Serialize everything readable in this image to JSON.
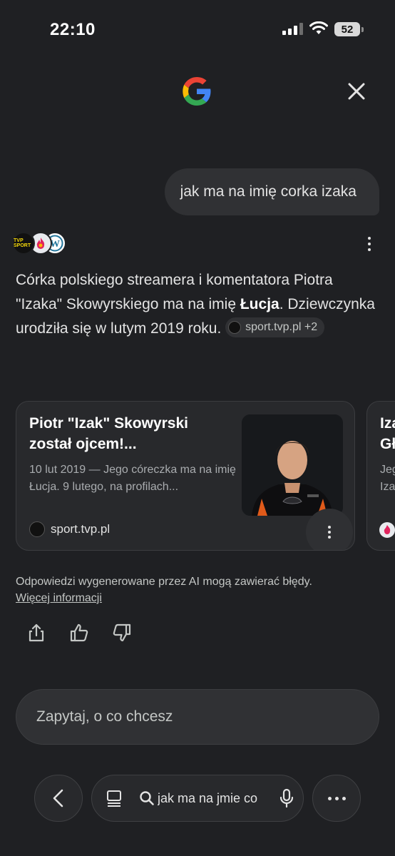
{
  "status_bar": {
    "time": "22:10",
    "battery": "52"
  },
  "conversation": {
    "query": "jak ma na imię corka izaka",
    "sources_icons": [
      "tvp-sport-logo",
      "fire-logo",
      "wordpress-logo"
    ],
    "tvp_logo_text": "TVP SPORT",
    "answer_part1": "Córka polskiego streamera i komentatora Piotra \"Izaka\" Skowyrskiego ma na imię ",
    "answer_bold": "Łucja",
    "answer_part2": ". Dziewczynka urodziła się w lutym 2019 roku.",
    "source_chip": "sport.tvp.pl +2"
  },
  "cards": [
    {
      "title": "Piotr \"Izak\" Skowyrski został ojcem!...",
      "snippet": "10 lut 2019 — Jego córeczka ma na imię Łucja. 9 lutego, na profilach...",
      "source": "sport.tvp.pl",
      "image": "man-in-gaming-jersey"
    },
    {
      "title_line1": "Iza",
      "title_line2": "Gł",
      "snippet_line1": "Jeg",
      "snippet_line2": "Iza"
    }
  ],
  "disclaimer": {
    "text": "Odpowiedzi wygenerowane przez AI mogą zawierać błędy.",
    "link": "Więcej informacji"
  },
  "ask_input": {
    "placeholder": "Zapytaj, o co chcesz"
  },
  "bottom_nav": {
    "url_text": "jak ma na jmie co"
  },
  "colors": {
    "background": "#1f2023",
    "surface": "#303134",
    "card": "#28292c"
  }
}
